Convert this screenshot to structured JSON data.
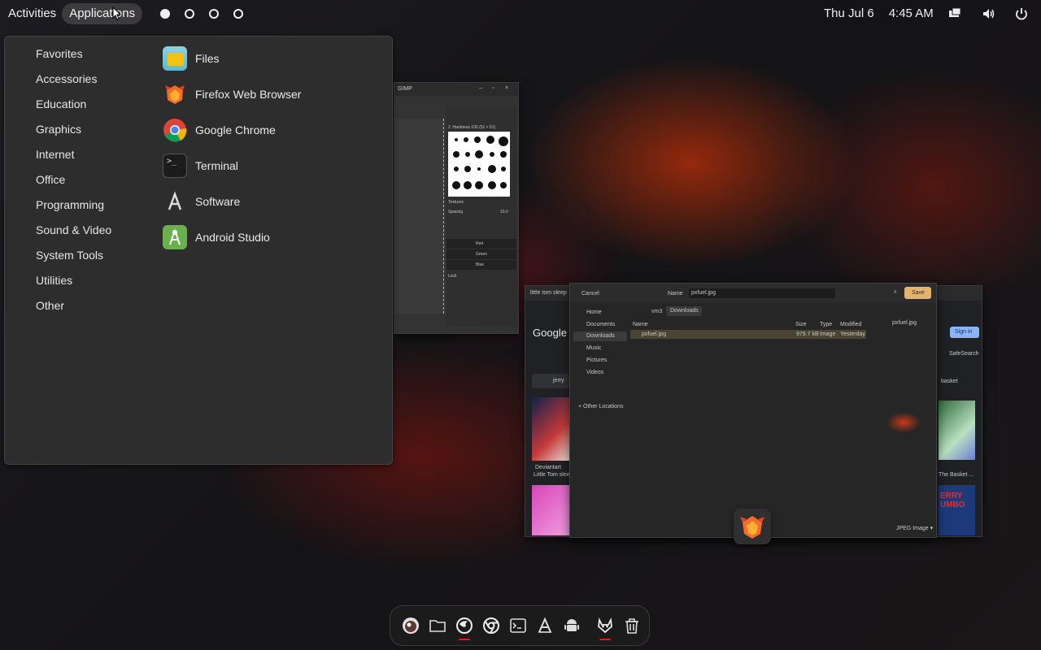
{
  "topbar": {
    "activities": "Activities",
    "applications": "Applications",
    "date": "Thu Jul 6",
    "time": "4:45 AM",
    "tray_icons": [
      "display-icon",
      "volume-icon",
      "power-icon"
    ]
  },
  "menu": {
    "categories": [
      "Favorites",
      "Accessories",
      "Education",
      "Graphics",
      "Internet",
      "Office",
      "Programming",
      "Sound & Video",
      "System Tools",
      "Utilities",
      "Other"
    ],
    "apps": [
      {
        "label": "Files",
        "icon": "files-icon"
      },
      {
        "label": "Firefox Web Browser",
        "icon": "firefox-icon"
      },
      {
        "label": "Google Chrome",
        "icon": "chrome-icon"
      },
      {
        "label": "Terminal",
        "icon": "terminal-icon"
      },
      {
        "label": "Software",
        "icon": "software-icon"
      },
      {
        "label": "Android Studio",
        "icon": "android-studio-icon"
      }
    ]
  },
  "gimp": {
    "title": "GIMP",
    "brush_name": "2. Hardness 100 (51 × 51)",
    "layers": [
      "Red",
      "Green",
      "Blue"
    ],
    "spacing_label": "Spacing",
    "spacing_value": "10.0",
    "filter_label": "Textures",
    "lock_label": "Lock"
  },
  "chrome": {
    "tab": "little tom sleep",
    "google": "Google",
    "sign_in": "Sign in",
    "safesearch": "SafeSearch",
    "chip_left": "jerry",
    "chip_right": "basket",
    "caption_left_source": "Deviantart",
    "caption_left": "Little Tom sleep...",
    "caption_right": "The Basket ...",
    "thumb_right_text": "ERRY\nUMBO"
  },
  "save_dialog": {
    "cancel": "Cancel",
    "name_label": "Name",
    "filename": "pxfuel.jpg",
    "save": "Save",
    "places": [
      "Home",
      "Documents",
      "Downloads",
      "Music",
      "Pictures",
      "Videos"
    ],
    "other_locations": "+ Other Locations",
    "path": [
      "vm3",
      "Downloads"
    ],
    "columns": [
      "Name",
      "Size",
      "Type",
      "Modified"
    ],
    "files": [
      {
        "name": "pxfuel.jpg",
        "size": "979.7 kB",
        "type": "Image",
        "modified": "Yesterday"
      }
    ],
    "preview_name": "pxfuel.jpg",
    "filter": "JPEG Image ▾"
  },
  "dock": {
    "items": [
      "gimp-icon",
      "files-icon",
      "firefox-icon",
      "chrome-icon",
      "terminal-icon",
      "software-icon",
      "android-studio-icon",
      "gitlab-icon",
      "trash-icon"
    ]
  },
  "colors": {
    "accent_running": "#e01b24",
    "menu_bg": "#2d2d2d",
    "save_button": "#e4b36e"
  }
}
